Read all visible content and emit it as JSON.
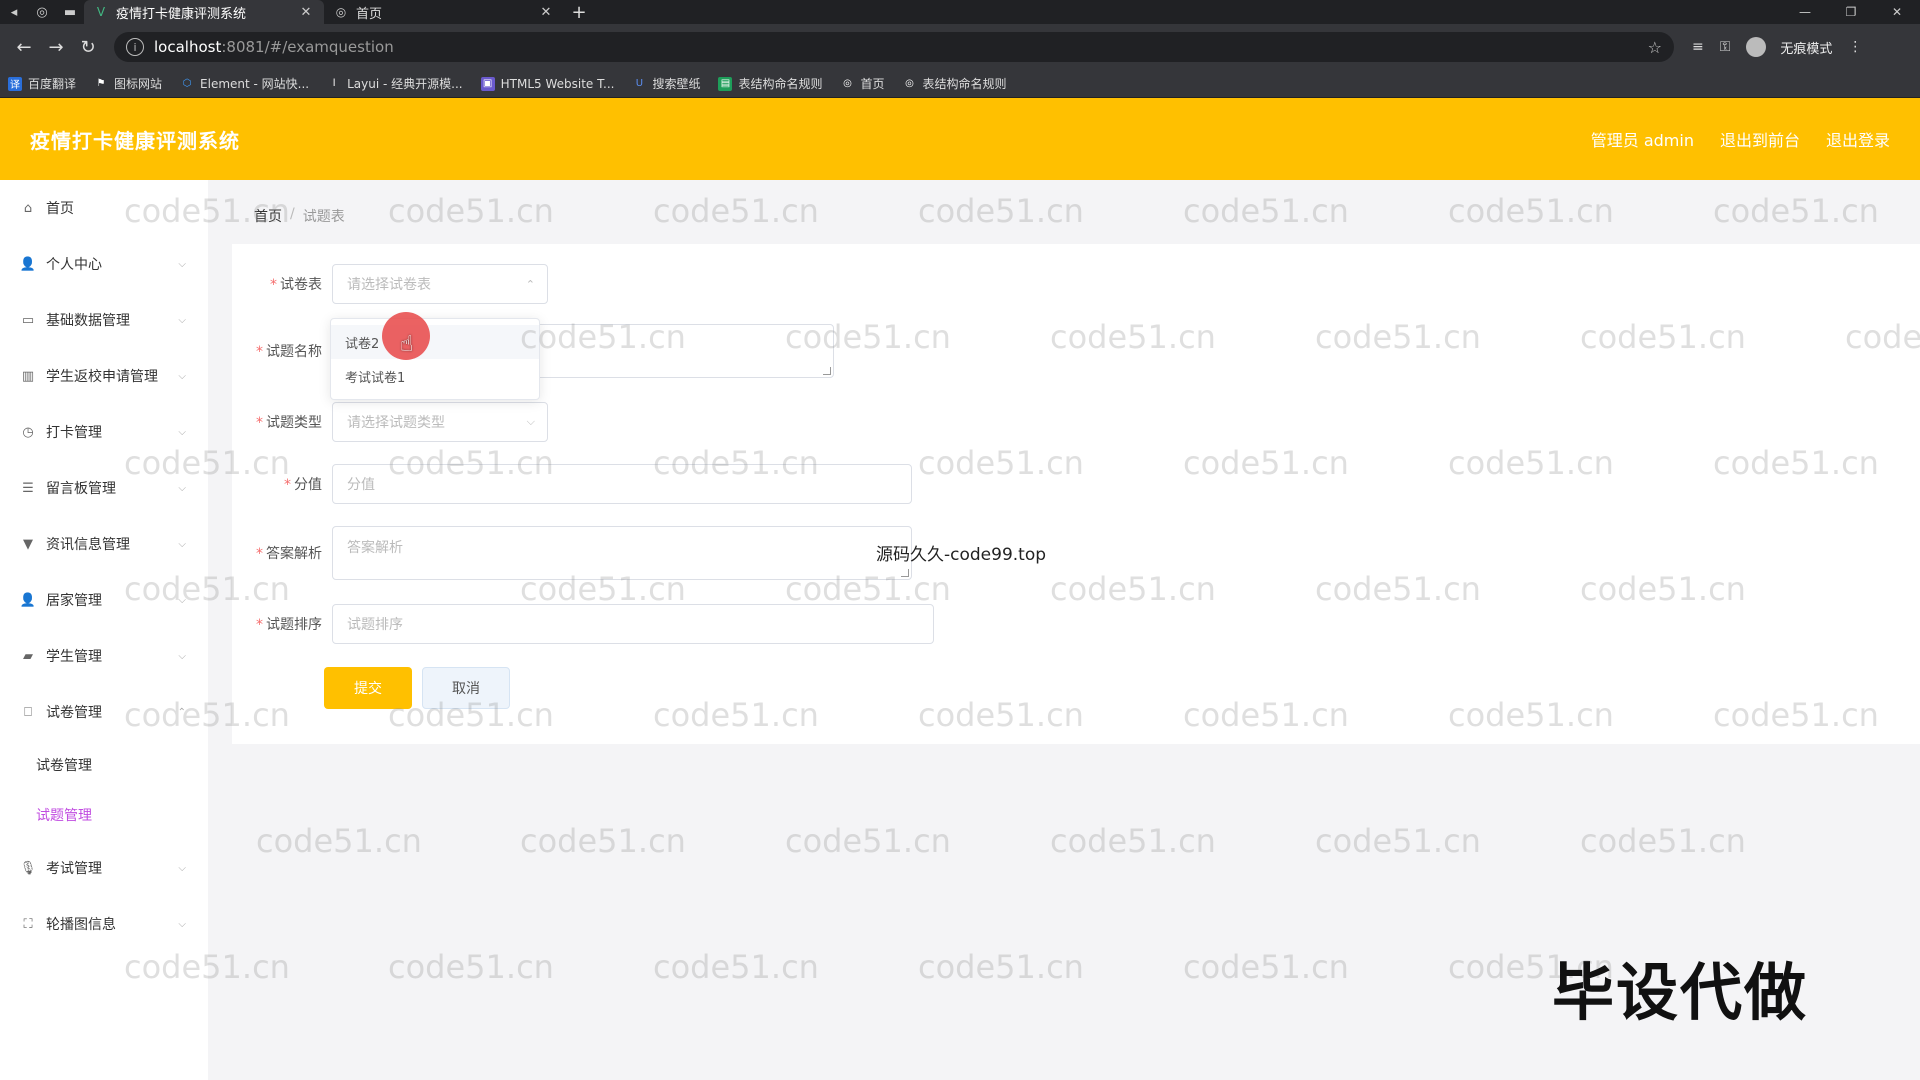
{
  "browser": {
    "tabs": [
      {
        "title": "疫情打卡健康评测系统",
        "active": true
      },
      {
        "title": "首页",
        "active": false
      }
    ],
    "url_host": "localhost",
    "url_path": ":8081/#/examquestion",
    "incognito_label": "无痕模式",
    "bookmarks": [
      "百度翻译",
      "图标网站",
      "Element - 网站快...",
      "Layui - 经典开源模...",
      "HTML5 Website T...",
      "搜索壁纸",
      "表结构命名规则",
      "首页",
      "表结构命名规则"
    ]
  },
  "header": {
    "title": "疫情打卡健康评测系统",
    "admin_label": "管理员 admin",
    "to_front_label": "退出到前台",
    "logout_label": "退出登录",
    "color": "#ffc000"
  },
  "sidebar": {
    "items": [
      {
        "label": "首页",
        "icon": "home-icon"
      },
      {
        "label": "个人中心",
        "icon": "user-icon"
      },
      {
        "label": "基础数据管理",
        "icon": "database-icon"
      },
      {
        "label": "学生返校申请管理",
        "icon": "bar-chart-icon"
      },
      {
        "label": "打卡管理",
        "icon": "clock-icon"
      },
      {
        "label": "留言板管理",
        "icon": "sliders-icon"
      },
      {
        "label": "资讯信息管理",
        "icon": "news-icon"
      },
      {
        "label": "居家管理",
        "icon": "user-icon"
      },
      {
        "label": "学生管理",
        "icon": "briefcase-icon"
      },
      {
        "label": "试卷管理",
        "icon": "paper-icon"
      }
    ],
    "sub_items": [
      {
        "label": "试卷管理",
        "active": false
      },
      {
        "label": "试题管理",
        "active": true
      }
    ],
    "items_after": [
      {
        "label": "考试管理",
        "icon": "mic-icon"
      },
      {
        "label": "轮播图信息",
        "icon": "image-icon"
      }
    ]
  },
  "breadcrumb": {
    "home": "首页",
    "current": "试题表"
  },
  "form": {
    "paper_label": "试卷表",
    "paper_placeholder": "请选择试卷表",
    "name_label": "试题名称",
    "type_label": "试题类型",
    "type_placeholder": "请选择试题类型",
    "score_label": "分值",
    "score_placeholder": "分值",
    "analysis_label": "答案解析",
    "analysis_placeholder": "答案解析",
    "order_label": "试题排序",
    "order_placeholder": "试题排序",
    "submit_label": "提交",
    "cancel_label": "取消"
  },
  "dropdown": {
    "options": [
      "试卷2",
      "考试试卷1"
    ]
  },
  "overlays": {
    "watermark": "code51.cn",
    "code99": "源码久久-code99.top",
    "bisheng": "毕设代做"
  }
}
